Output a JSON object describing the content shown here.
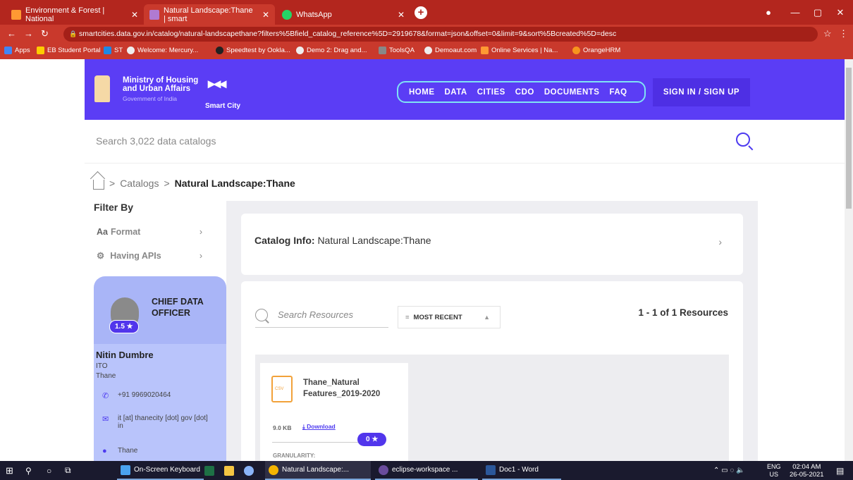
{
  "browser": {
    "tabs": [
      {
        "title": "Environment & Forest | National",
        "color": "#ff9933"
      },
      {
        "title": "Natural Landscape:Thane | smart",
        "color": "#b07ad1"
      },
      {
        "title": "WhatsApp",
        "color": "#25d366"
      }
    ],
    "url": "smartcities.data.gov.in/catalog/natural-landscapethane?filters%5Bfield_catalog_reference%5D=2919678&format=json&offset=0&limit=9&sort%5Bcreated%5D=desc",
    "bookmarks": [
      "Apps",
      "EB Student Portal",
      "ST",
      "Welcome: Mercury...",
      "Speedtest by Ookla...",
      "Demo 2: Drag and...",
      "ToolsQA",
      "Demoaut.com",
      "Online Services | Na...",
      "OrangeHRM"
    ]
  },
  "header": {
    "ministry": "Ministry of Housing and Urban Affairs",
    "government": "Government of India",
    "smart_city": "Smart City",
    "nav": [
      "HOME",
      "DATA",
      "CITIES",
      "CDO",
      "DOCUMENTS",
      "FAQ"
    ],
    "signin": "SIGN IN / SIGN UP"
  },
  "search": {
    "placeholder": "Search 3,022 data catalogs"
  },
  "breadcrumb": {
    "catalogs": "Catalogs",
    "current": "Natural Landscape:Thane"
  },
  "filters": {
    "title": "Filter By",
    "format": "Format",
    "format_prefix": "Aa",
    "apis": "Having APIs"
  },
  "cdo": {
    "title": "CHIEF DATA OFFICER",
    "rating": "1.5 ★",
    "name": "Nitin Dumbre",
    "role": "ITO",
    "city": "Thane",
    "phone": "+91 9969020464",
    "email": "it [at] thanecity [dot] gov [dot] in",
    "location": "Thane"
  },
  "catalog_info": {
    "label": "Catalog Info:",
    "name": "Natural Landscape:Thane"
  },
  "resources": {
    "search_placeholder": "Search Resources",
    "sort": "MOST RECENT",
    "count": "1 - 1 of 1 Resources",
    "items": [
      {
        "name": "Thane_Natural Features_2019-2020",
        "type": "CSV",
        "size": "9.0 KB",
        "download": "Download",
        "rating": "0 ★",
        "granularity": "GRANULARITY:"
      }
    ]
  },
  "taskbar": {
    "apps": [
      "On-Screen Keyboard",
      "Natural Landscape:...",
      "eclipse-workspace ...",
      "Doc1 - Word"
    ],
    "lang": "ENG",
    "region": "US",
    "time": "02:04 AM",
    "date": "26-05-2021"
  }
}
